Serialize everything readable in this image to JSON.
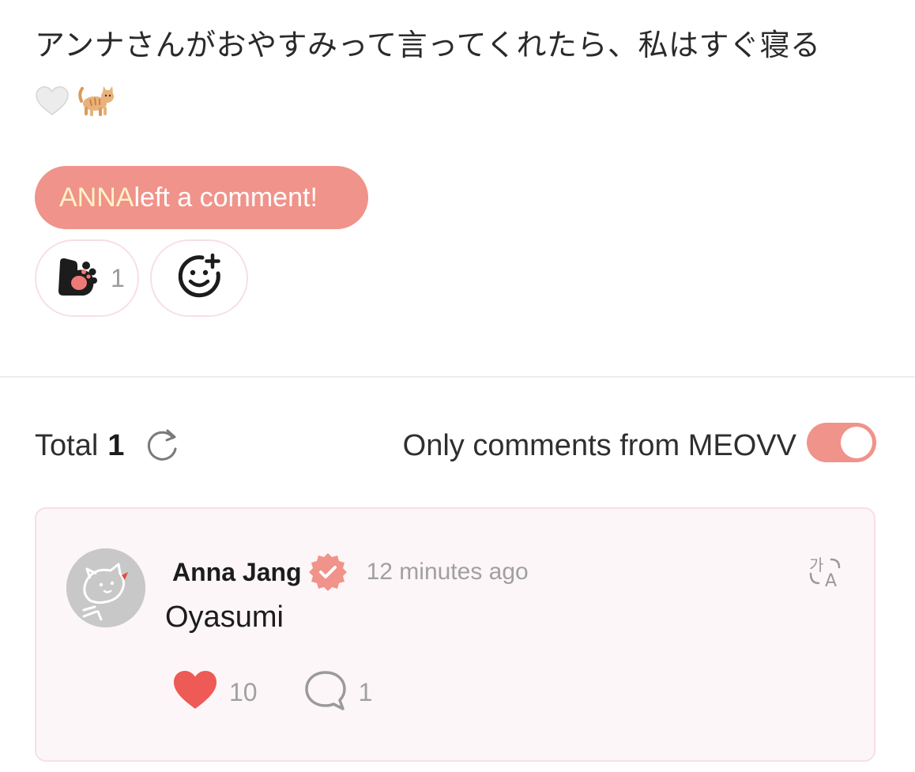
{
  "post": {
    "text": "アンナさんがおやすみって言ってくれたら、私はすぐ寝る",
    "emojis": [
      "white-heart",
      "cat"
    ]
  },
  "banner": {
    "name": "ANNA",
    "text": "left a comment!"
  },
  "reactions": [
    {
      "icon": "paw-icon",
      "count": "1"
    },
    {
      "icon": "add-reaction-icon"
    }
  ],
  "comments_header": {
    "total_label": "Total",
    "total_count": "1",
    "filter_label": "Only comments from MEOVV",
    "filter_on": true
  },
  "comment": {
    "author": "Anna Jang",
    "verified": true,
    "time": "12 minutes ago",
    "body": "Oyasumi",
    "likes": "10",
    "replies": "1"
  },
  "colors": {
    "accent": "#f0938a",
    "banner_name": "#fff3c4",
    "card_bg": "#fdf6f8",
    "card_border": "#f7dfe6",
    "heart": "#ee5a55",
    "muted": "#a0a0a0"
  }
}
